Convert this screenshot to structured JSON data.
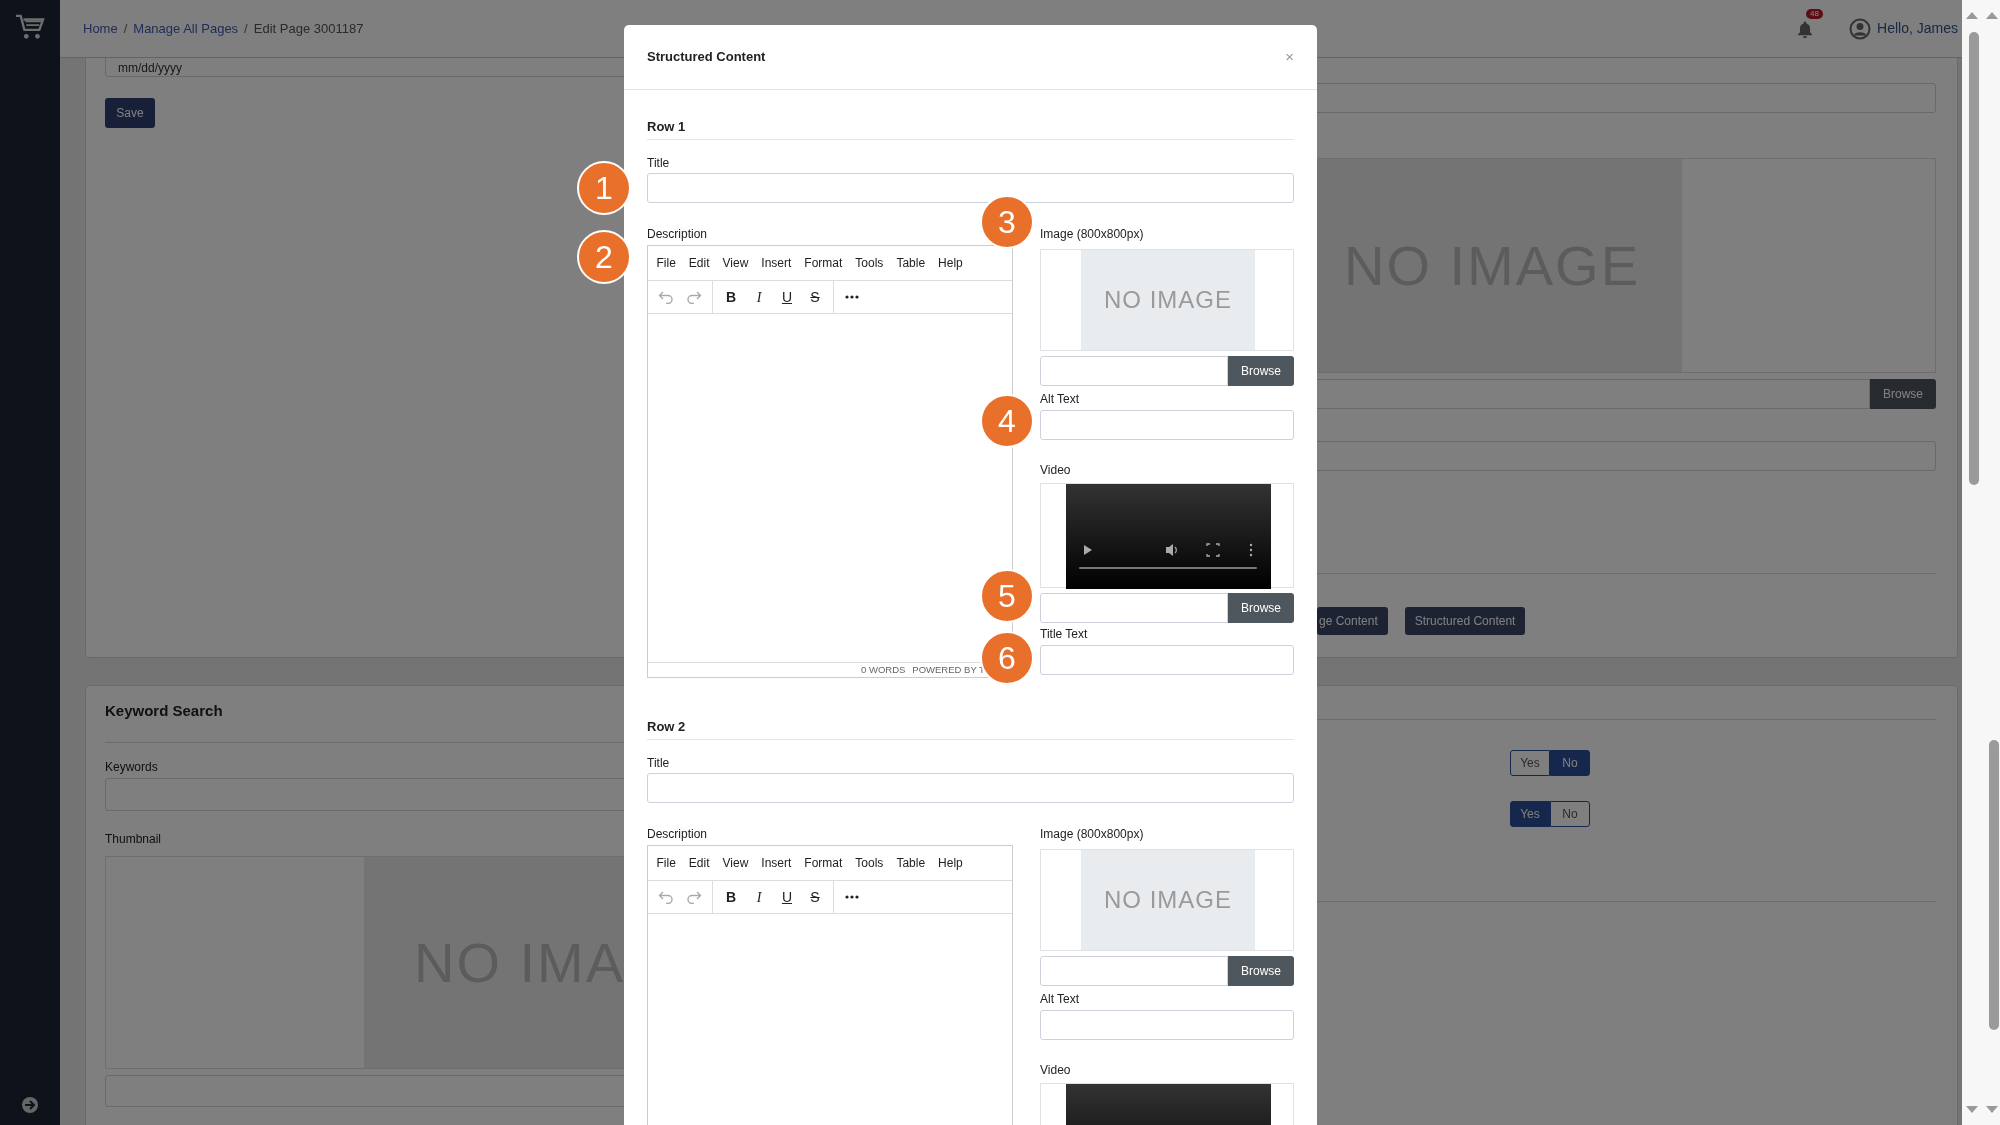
{
  "breadcrumb": [
    {
      "label": "Home",
      "current": false
    },
    {
      "separator": "/",
      "label": "Manage All Pages",
      "current": false
    },
    {
      "separator": "/",
      "label": "Edit Page 3001187",
      "current": true
    }
  ],
  "notifications": {
    "count": "48"
  },
  "user": {
    "greeting": "Hello, James"
  },
  "page": {
    "date_field": {
      "placeholder": "mm/dd/yyyy"
    },
    "save_button": "Save",
    "image_placeholder": "NO IMAGE",
    "browse_button": "Browse",
    "content_buttons": [
      "ge Content",
      "Structured Content"
    ],
    "keyword_search": {
      "title": "Keyword Search",
      "keywords_label": "Keywords",
      "thumbnail_label": "Thumbnail",
      "thumbnail_placeholder": "NO IMA"
    },
    "toggles": [
      {
        "options": [
          {
            "label": "Yes",
            "selected": false
          },
          {
            "label": "No",
            "selected": true
          }
        ]
      },
      {
        "options": [
          {
            "label": "Yes",
            "selected": true
          },
          {
            "label": "No",
            "selected": false
          }
        ]
      }
    ]
  },
  "modal": {
    "title": "Structured Content",
    "close": "×",
    "rows": [
      {
        "heading": "Row 1",
        "title_label": "Title",
        "description_label": "Description",
        "editor": {
          "menu": [
            "File",
            "Edit",
            "View",
            "Insert",
            "Format",
            "Tools",
            "Table",
            "Help"
          ],
          "toolbar": [
            {
              "kind": "undo",
              "disabled": true
            },
            {
              "kind": "redo",
              "disabled": true
            },
            {
              "kind": "bold",
              "glyph": "B",
              "disabled": false
            },
            {
              "kind": "italic",
              "glyph": "I",
              "disabled": false
            },
            {
              "kind": "underline",
              "glyph": "U",
              "disabled": false
            },
            {
              "kind": "strikethrough",
              "glyph": "S",
              "disabled": false
            },
            {
              "kind": "more",
              "disabled": false
            }
          ],
          "status": [
            "0 WORDS",
            "POWERED BY T"
          ]
        },
        "image_label": "Image (800x800px)",
        "image_placeholder": "NO IMAGE",
        "image_browse": "Browse",
        "alt_text_label": "Alt Text",
        "video_label": "Video",
        "video_browse": "Browse",
        "title_text_label": "Title Text"
      },
      {
        "heading": "Row 2",
        "title_label": "Title",
        "description_label": "Description",
        "editor": {
          "menu": [
            "File",
            "Edit",
            "View",
            "Insert",
            "Format",
            "Tools",
            "Table",
            "Help"
          ],
          "toolbar": [
            {
              "kind": "undo",
              "disabled": true
            },
            {
              "kind": "redo",
              "disabled": true
            },
            {
              "kind": "bold",
              "glyph": "B",
              "disabled": false
            },
            {
              "kind": "italic",
              "glyph": "I",
              "disabled": false
            },
            {
              "kind": "underline",
              "glyph": "U",
              "disabled": false
            },
            {
              "kind": "strikethrough",
              "glyph": "S",
              "disabled": false
            },
            {
              "kind": "more",
              "disabled": false
            }
          ]
        },
        "image_label": "Image (800x800px)",
        "image_placeholder": "NO IMAGE",
        "image_browse": "Browse",
        "alt_text_label": "Alt Text",
        "video_label": "Video"
      }
    ]
  },
  "annotations": [
    {
      "number": "1"
    },
    {
      "number": "2"
    },
    {
      "number": "3"
    },
    {
      "number": "4"
    },
    {
      "number": "5"
    },
    {
      "number": "6"
    }
  ]
}
